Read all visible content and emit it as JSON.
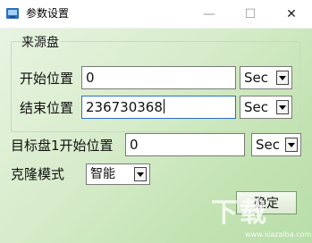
{
  "window": {
    "title": "参数设置",
    "minimize_symbol": "—",
    "maximize_symbol": "☐",
    "close_symbol": "✕"
  },
  "source_group": {
    "title": "来源盘",
    "start_label": "开始位置",
    "start_value": "0",
    "start_unit": "Sec",
    "end_label": "结束位置",
    "end_value": "236730368",
    "end_unit": "Sec"
  },
  "target": {
    "label": "目标盘1开始位置",
    "value": "0",
    "unit": "Sec"
  },
  "clone_mode": {
    "label": "克隆模式",
    "value": "智能"
  },
  "ok_button": "确定",
  "watermark": {
    "text": "下载",
    "sub": "www.xiazaiba.com"
  },
  "colors": {
    "gradient_light": "#eaf5e4",
    "gradient_dark": "#b9deaa",
    "focus_border": "#2b6ec4"
  }
}
